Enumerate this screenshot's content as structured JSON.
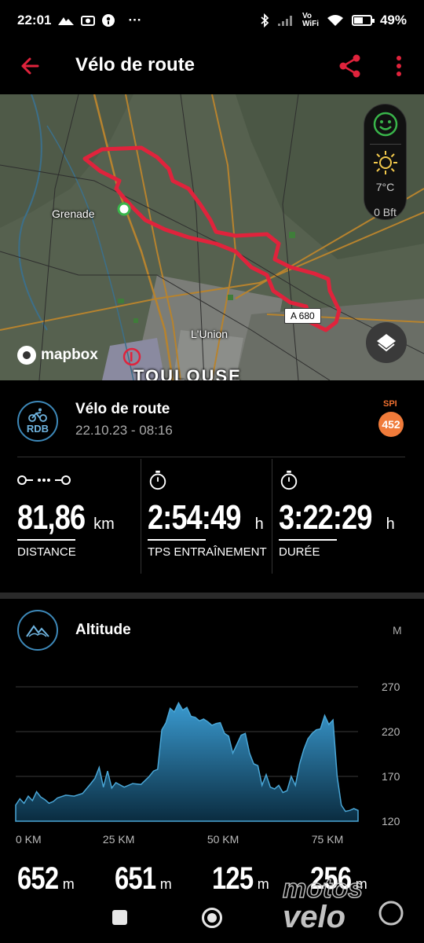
{
  "status_bar": {
    "time": "22:01",
    "dots": "···",
    "vowifi": "Vo\nWiFi",
    "battery": "49%",
    "battery_level": 0.49
  },
  "app_bar": {
    "title": "Vélo de route"
  },
  "map": {
    "towns": [
      "Grenade",
      "L'Union",
      "TOULOUSE"
    ],
    "road": "A 680",
    "attribution": "mapbox",
    "weather": {
      "temp": "7°C",
      "wind": "0 Bft"
    }
  },
  "activity": {
    "abbr": "RDB",
    "name": "Vélo de route",
    "date": "22.10.23 - 08:16",
    "spi_label": "SPI",
    "spi_value": "452"
  },
  "stats": [
    {
      "value": "81,86",
      "unit": "km",
      "label": "DISTANCE",
      "icon": "route-icon"
    },
    {
      "value": "2:54:49",
      "unit": "h",
      "label": "TPS ENTRAÎNEMENT",
      "icon": "stopwatch-icon"
    },
    {
      "value": "3:22:29",
      "unit": "h",
      "label": "DURÉE",
      "icon": "stopwatch-icon"
    }
  ],
  "altitude": {
    "title": "Altitude",
    "unit": "M"
  },
  "chart_data": {
    "type": "area",
    "title": "Altitude",
    "xlabel": "",
    "ylabel": "M",
    "x_ticks": [
      "0 KM",
      "25 KM",
      "50 KM",
      "75 KM"
    ],
    "y_ticks": [
      "270",
      "220",
      "170",
      "120"
    ],
    "ylim": [
      120,
      270
    ],
    "xlim": [
      0,
      82
    ],
    "x": [
      0,
      1,
      2,
      3,
      4,
      5,
      6,
      7,
      8,
      9,
      10,
      12,
      14,
      16,
      18,
      19,
      20,
      21,
      22,
      23,
      24,
      26,
      28,
      30,
      32,
      33,
      34,
      35,
      36,
      37,
      38,
      39,
      40,
      41,
      42,
      43,
      44,
      45,
      46,
      47,
      48,
      49,
      50,
      51,
      52,
      53,
      54,
      55,
      56,
      57,
      58,
      59,
      60,
      61,
      62,
      63,
      64,
      65,
      66,
      67,
      68,
      69,
      70,
      71,
      72,
      73,
      74,
      75,
      76,
      77,
      78,
      79,
      80,
      81,
      82
    ],
    "values": [
      138,
      145,
      140,
      148,
      143,
      153,
      147,
      144,
      140,
      142,
      146,
      149,
      148,
      151,
      162,
      168,
      180,
      158,
      176,
      157,
      163,
      158,
      162,
      161,
      170,
      176,
      178,
      222,
      230,
      246,
      242,
      252,
      244,
      247,
      237,
      236,
      232,
      234,
      231,
      227,
      229,
      230,
      218,
      215,
      196,
      206,
      216,
      218,
      196,
      184,
      182,
      160,
      172,
      158,
      156,
      160,
      152,
      154,
      170,
      160,
      184,
      200,
      212,
      218,
      222,
      223,
      238,
      228,
      233,
      170,
      138,
      131,
      132,
      134,
      132
    ]
  },
  "summary": [
    {
      "value": "652",
      "unit": "m"
    },
    {
      "value": "651",
      "unit": "m"
    },
    {
      "value": "125",
      "unit": "m"
    },
    {
      "value": "256",
      "unit": "m"
    }
  ],
  "watermark": {
    "line1": "motos",
    "line2": "velo"
  },
  "colors": {
    "route": "#e0233c",
    "accent_blue": "#3d88b8",
    "spi": "#f07b3a",
    "chart_fill": "#2f86b3",
    "chart_line": "#4aa6d6",
    "back_arrow": "#e0233c"
  }
}
